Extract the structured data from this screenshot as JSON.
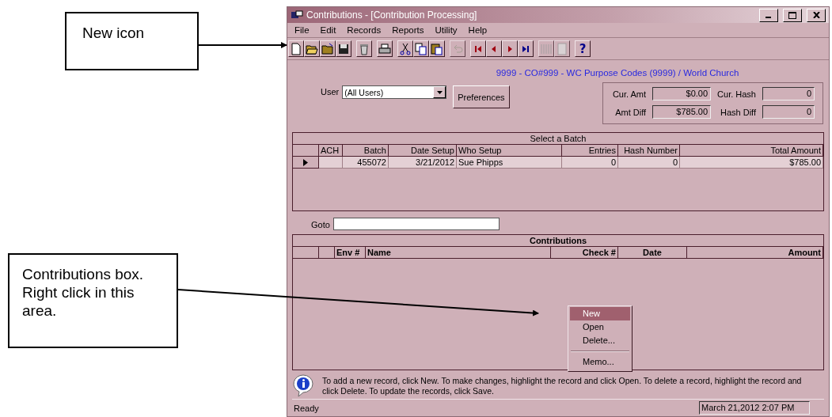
{
  "annotations": [
    {
      "text": "New icon"
    },
    {
      "text": "Contributions box.  Right click in this area."
    }
  ],
  "window": {
    "title": "Contributions - [Contribution Processing]"
  },
  "menu": [
    "File",
    "Edit",
    "Records",
    "Reports",
    "Utility",
    "Help"
  ],
  "toolbar": [
    {
      "kind": "new",
      "disabled": false
    },
    {
      "kind": "open",
      "disabled": false
    },
    {
      "kind": "folder",
      "disabled": false
    },
    {
      "kind": "save",
      "disabled": false
    },
    {
      "kind": "delete",
      "disabled": false
    },
    {
      "kind": "print",
      "disabled": false
    },
    {
      "kind": "cut",
      "disabled": false
    },
    {
      "kind": "copy",
      "disabled": false
    },
    {
      "kind": "paste",
      "disabled": false
    },
    {
      "kind": "undo",
      "disabled": true
    },
    {
      "kind": "first",
      "disabled": false
    },
    {
      "kind": "prev",
      "disabled": false
    },
    {
      "kind": "next",
      "disabled": false
    },
    {
      "kind": "last",
      "disabled": false
    },
    {
      "kind": "columns",
      "disabled": true
    },
    {
      "kind": "report",
      "disabled": true
    },
    {
      "kind": "help",
      "disabled": false,
      "label": "?"
    }
  ],
  "header": "9999 - CO#999 - WC Purpose Codes (9999) / World Church",
  "user": {
    "label": "User",
    "value": "(All Users)"
  },
  "preferences": "Preferences",
  "totals": [
    {
      "label": "Cur. Amt",
      "value": "$0.00"
    },
    {
      "label": "Cur. Hash",
      "value": "0"
    },
    {
      "label": "Amt Diff",
      "value": "$785.00"
    },
    {
      "label": "Hash Diff",
      "value": "0"
    }
  ],
  "batch_grid": {
    "title": "Select a Batch",
    "columns": [
      "ACH",
      "Batch",
      "Date Setup",
      "Who Setup",
      "Entries",
      "Hash Number",
      "Total Amount"
    ],
    "rows": [
      {
        "selected": true,
        "cells": [
          "",
          "455072",
          "3/21/2012",
          "Sue Phipps",
          "0",
          "0",
          "$785.00"
        ]
      }
    ]
  },
  "goto": {
    "label": "Goto"
  },
  "contributions_grid": {
    "title": "Contributions",
    "columns": [
      "Env #",
      "Name",
      "Check #",
      "Date",
      "Amount"
    ]
  },
  "context_menu": [
    {
      "kind": "item",
      "label": "New",
      "selected": true
    },
    {
      "kind": "item",
      "label": "Open",
      "selected": false
    },
    {
      "kind": "item",
      "label": "Delete...",
      "selected": false
    },
    {
      "kind": "separator"
    },
    {
      "kind": "item",
      "label": "Memo...",
      "selected": false
    }
  ],
  "info": "To add a new record, click New.  To make changes, highlight the record and click Open.  To delete a record, highlight the record and click Delete. To update the records, click Save.",
  "status_bar": {
    "message": "Ready",
    "datetime": "March 21,2012 2:07 PM"
  }
}
